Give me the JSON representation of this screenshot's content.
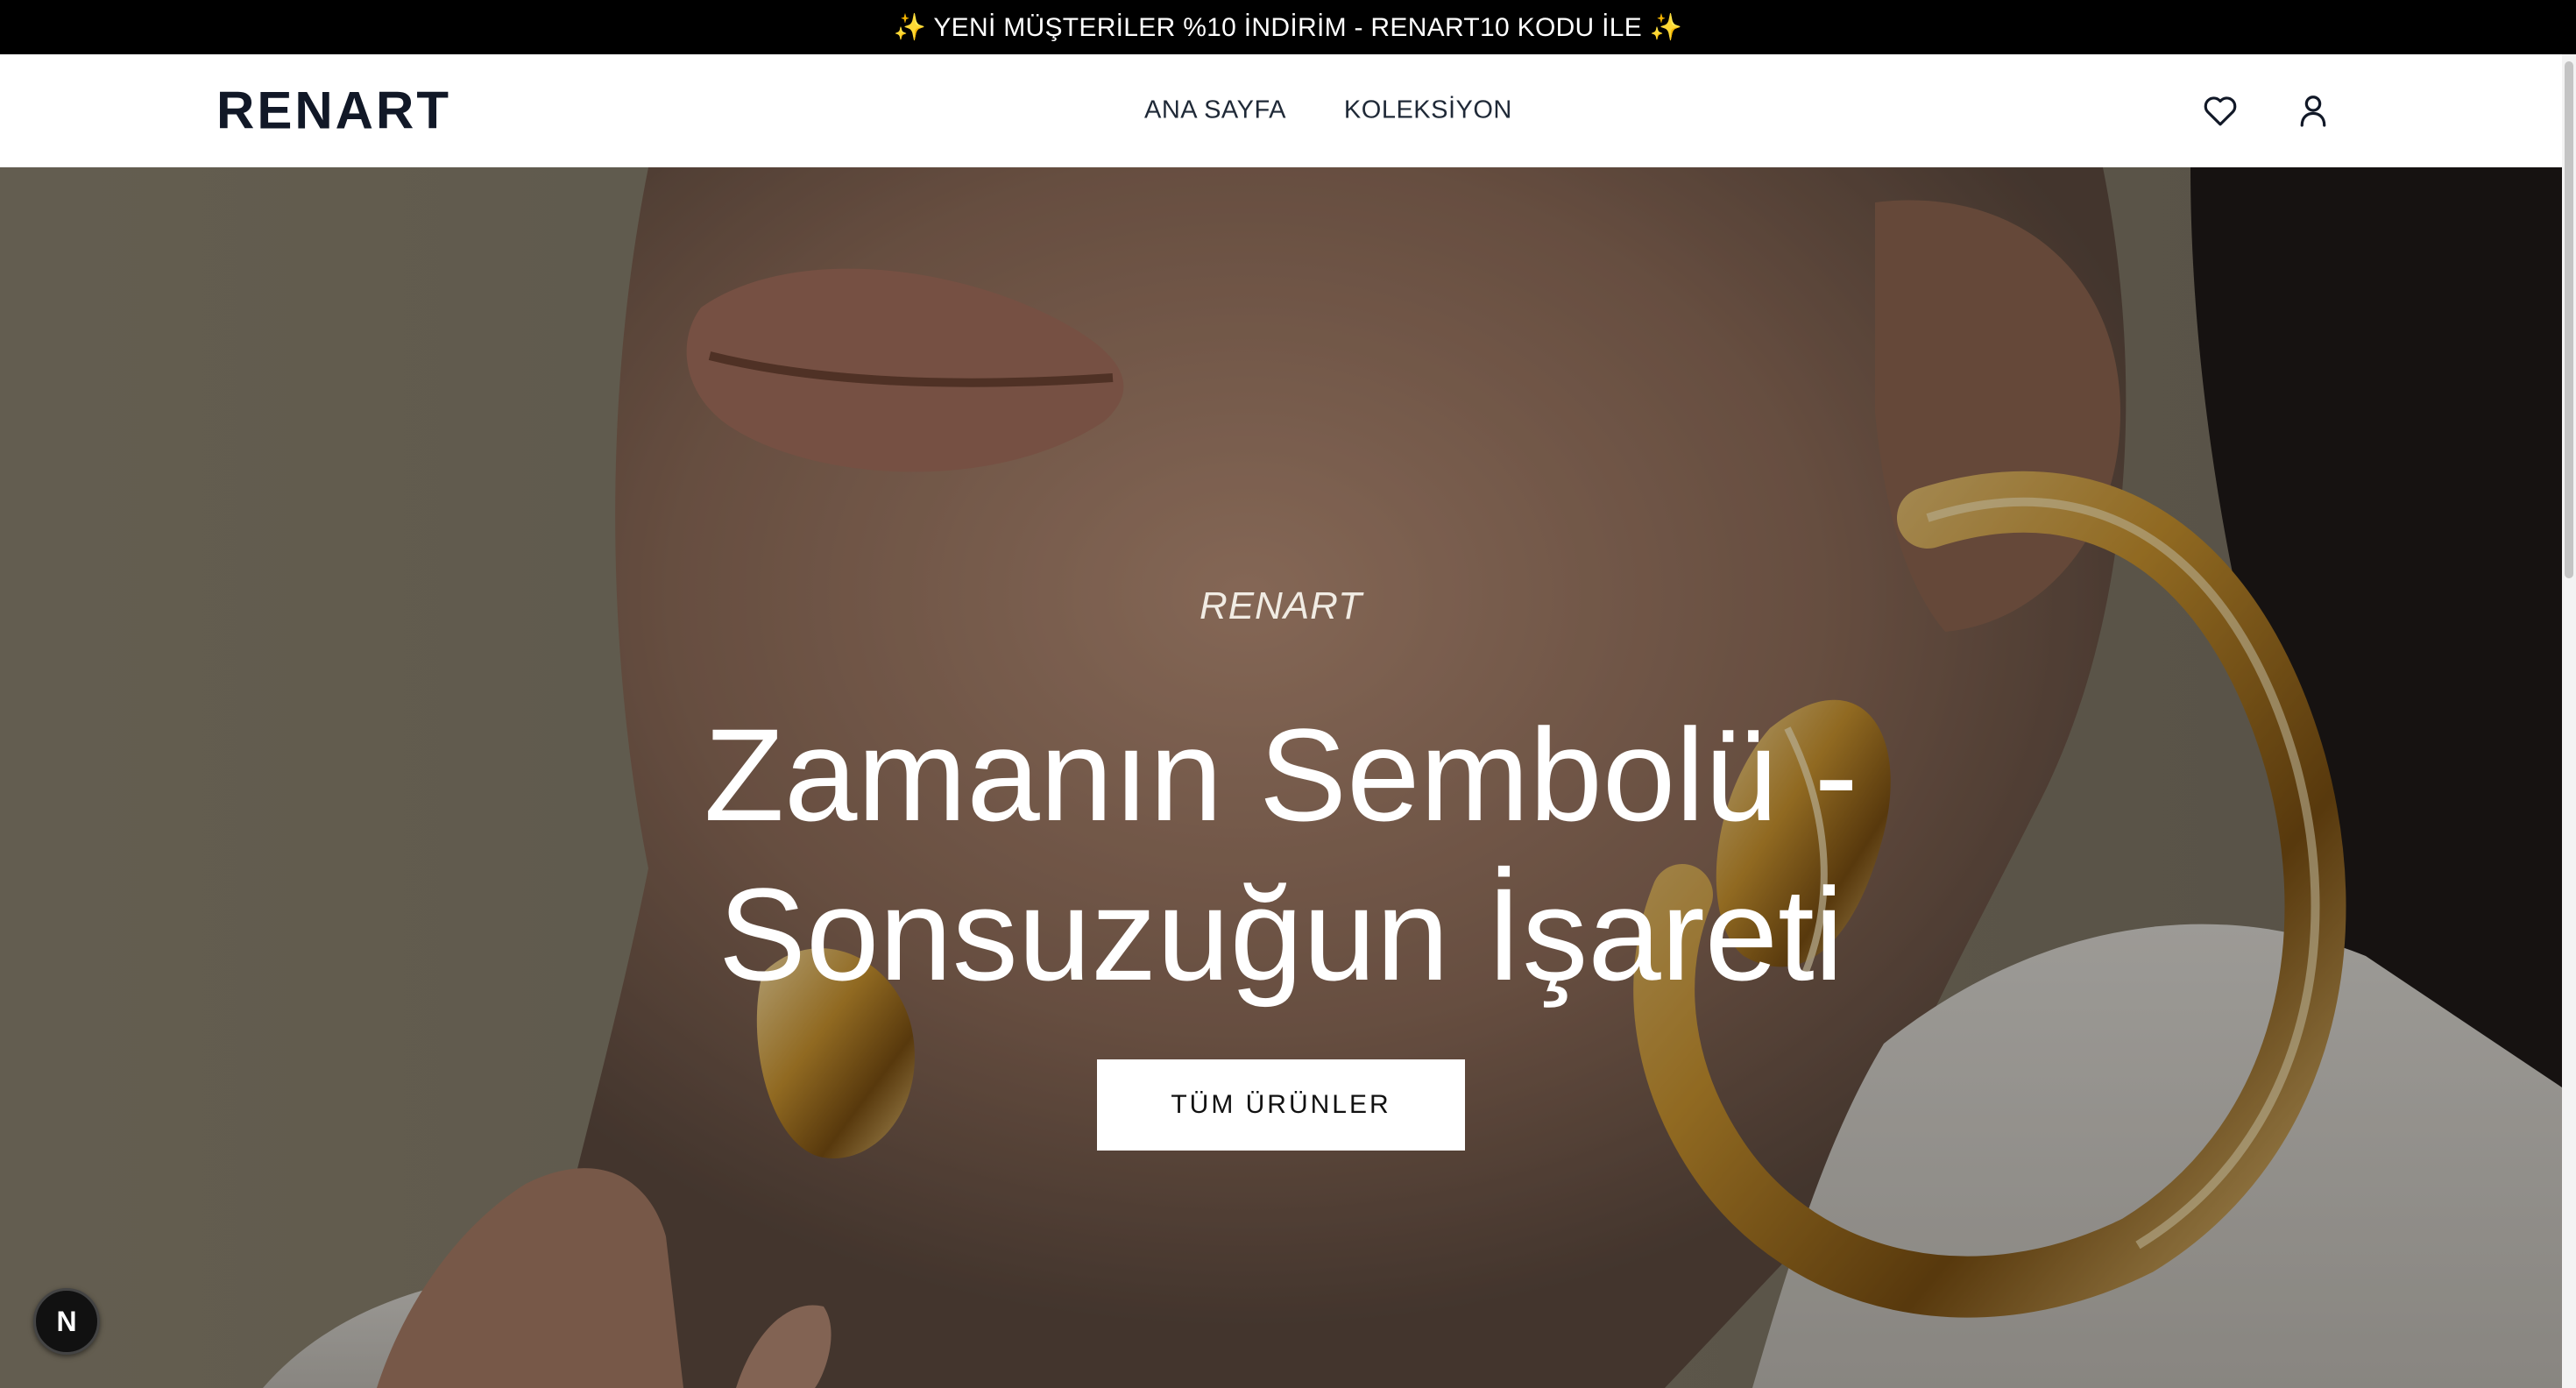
{
  "announcement": {
    "text": "✨ YENİ MÜŞTERİLER %10 İNDİRİM - RENART10 KODU İLE ✨"
  },
  "header": {
    "logo": "RENART",
    "nav": [
      {
        "label": "ANA SAYFA"
      },
      {
        "label": "KOLEKSİYON"
      }
    ],
    "icons": [
      "heart-icon",
      "user-icon"
    ]
  },
  "hero": {
    "eyebrow": "RENART",
    "title_line1": "Zamanın Sembolü -",
    "title_line2": "Sonsuzuğun İşareti",
    "cta": "TÜM ÜRÜNLER",
    "image": "close-up photo of woman's lips, chin and ear wearing large gold sculptural hoop earrings"
  },
  "dev_badge": {
    "label": "N",
    "icon": "nextjs-icon"
  },
  "colors": {
    "announce_bg": "#000000",
    "logo": "#111827",
    "button_bg": "#ffffff",
    "hero_overlay": "rgba(0,0,0,0.28)"
  }
}
